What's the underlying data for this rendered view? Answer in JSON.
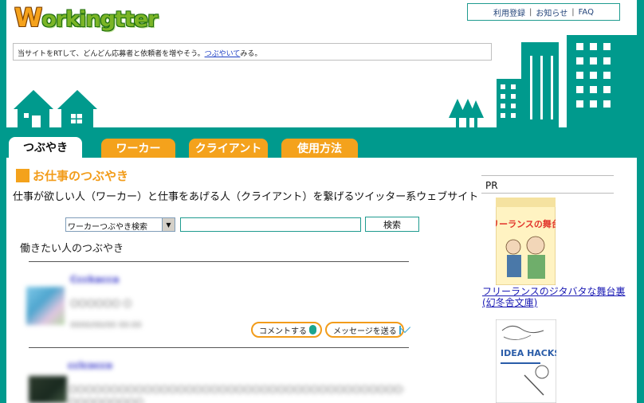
{
  "header": {
    "logo": {
      "initial": "W",
      "rest": "orkingtter"
    },
    "toplinks": [
      "利用登録",
      "お知らせ",
      "FAQ"
    ],
    "toplinks_separator": "|",
    "tweetbar": {
      "text_before": "当サイトをRTして、どんどん応募者と依頼者を増やそう。",
      "link": "つぶやいて",
      "text_after": "みる。"
    }
  },
  "nav": {
    "tabs": [
      {
        "label": "つぶやき",
        "active": true
      },
      {
        "label": "ワーカー",
        "active": false
      },
      {
        "label": "クライアント",
        "active": false
      },
      {
        "label": "使用方法",
        "active": false
      }
    ]
  },
  "main": {
    "section_title": "お仕事のつぶやき",
    "subtitle": "仕事が欲しい人（ワーカー）と仕事をあげる人（クライアント）を繋げるツイッター系ウェブサイト",
    "search": {
      "select_value": "ワーカーつぶやき検索",
      "input_value": "",
      "button_label": "検索"
    },
    "feed_heading": "働きたい人のつぶやき",
    "actions": {
      "comment_label": "コメントする",
      "message_label": "メッセージを送る"
    }
  },
  "sidebar": {
    "pr_label": "PR",
    "book1_title": "フリーランスのジタバタな舞台裏(幻冬舎文庫)",
    "book1_cover_text": "フリーランスの舞台裏",
    "book2_cover_title": "IDEA HACKS!"
  },
  "colors": {
    "teal": "#009a8d",
    "orange": "#f4a21c",
    "link_blue": "#1a1ab4"
  }
}
